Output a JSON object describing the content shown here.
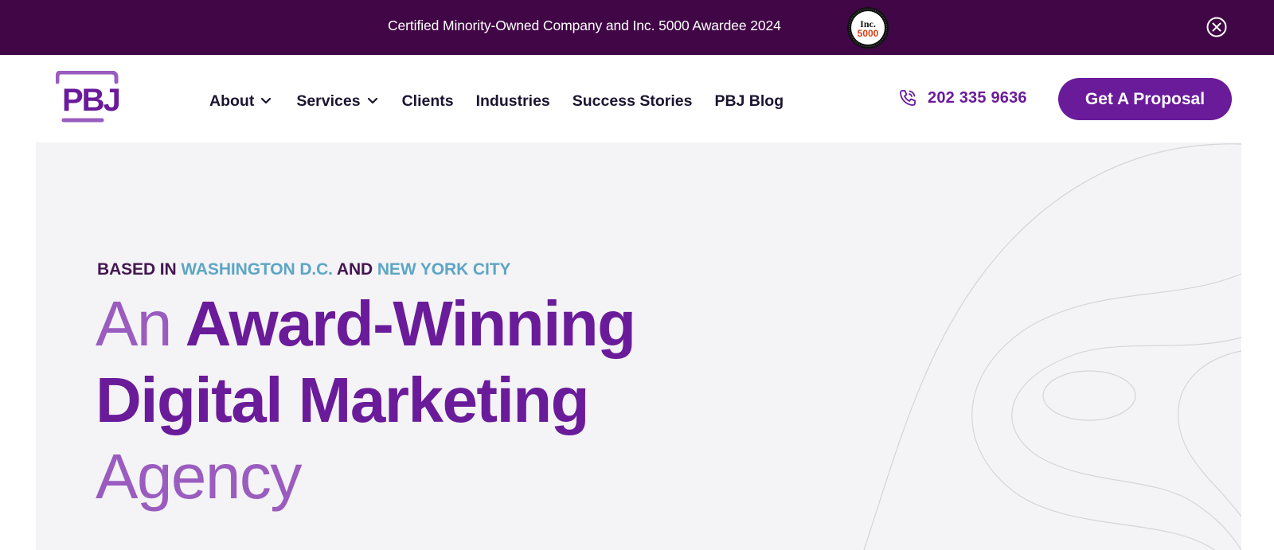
{
  "announcement": {
    "text": "Certified Minority-Owned Company and Inc. 5000 Awardee 2024",
    "badge_top": "Inc.",
    "badge_bottom": "5000",
    "close_icon": "close-circle-icon"
  },
  "header": {
    "logo_text": "PBJ",
    "nav": [
      {
        "label": "About",
        "has_dropdown": true
      },
      {
        "label": "Services",
        "has_dropdown": true
      },
      {
        "label": "Clients",
        "has_dropdown": false
      },
      {
        "label": "Industries",
        "has_dropdown": false
      },
      {
        "label": "Success Stories",
        "has_dropdown": false
      },
      {
        "label": "PBJ Blog",
        "has_dropdown": false
      }
    ],
    "phone": "202 335 9636",
    "phone_icon": "phone-icon",
    "cta_label": "Get A Proposal"
  },
  "hero": {
    "eyebrow": {
      "prefix": "BASED IN",
      "city1": "WASHINGTON D.C.",
      "connector": "AND",
      "city2": "NEW YORK CITY"
    },
    "headline": {
      "line1_light": "An",
      "line1_bold": "Award-Winning",
      "line2_bold": "Digital Marketing",
      "line3_light": "Agency"
    }
  },
  "colors": {
    "brand_purple": "#6a1b9a",
    "announcement_bg": "#400645",
    "hero_bg": "#f4f3f6",
    "accent_teal": "#5ca6c4",
    "light_purple": "#9a5cbf"
  }
}
